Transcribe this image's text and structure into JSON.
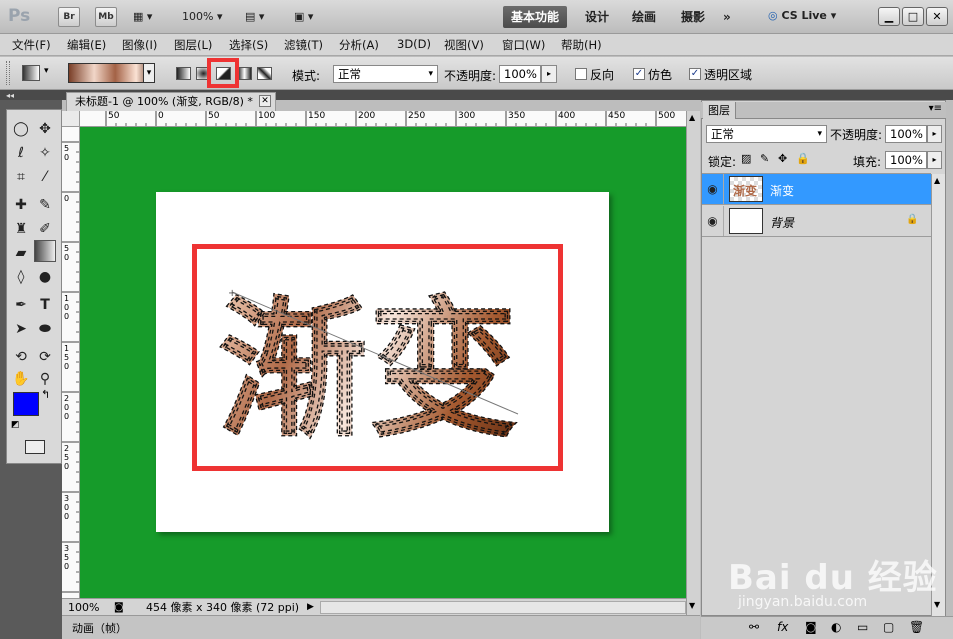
{
  "app": {
    "logo": "Ps",
    "bridge": "Br",
    "minibridge": "Mb",
    "zoom": "100%",
    "workspaces": [
      "基本功能",
      "设计",
      "绘画",
      "摄影"
    ],
    "more": "»",
    "cslive": "CS Live"
  },
  "menu": [
    "文件(F)",
    "编辑(E)",
    "图像(I)",
    "图层(L)",
    "选择(S)",
    "滤镜(T)",
    "分析(A)",
    "3D(D)",
    "视图(V)",
    "窗口(W)",
    "帮助(H)"
  ],
  "options": {
    "mode_label": "模式:",
    "mode_value": "正常",
    "opacity_label": "不透明度:",
    "opacity_value": "100%",
    "reverse_label": "反向",
    "dither_label": "仿色",
    "transparency_label": "透明区域",
    "dither_checked": true,
    "transparency_checked": true,
    "reverse_checked": false
  },
  "document": {
    "tab_title": "未标题-1 @ 100% (渐变, RGB/8) *",
    "ruler_h": [
      "50",
      "0",
      "50",
      "100",
      "150",
      "200",
      "250",
      "300",
      "350",
      "400",
      "450",
      "500"
    ],
    "ruler_v": [
      "5\n0",
      "0",
      "5\n0",
      "1\n0\n0",
      "1\n5\n0",
      "2\n0\n0",
      "2\n5\n0",
      "3\n0\n0",
      "3\n5\n0"
    ],
    "text": "渐变",
    "canvas_bg": "#169b2a"
  },
  "status": {
    "zoom": "100%",
    "info": "454 像素 x 340 像素 (72 ppi)"
  },
  "animation_tab": "动画（帧）",
  "layers": {
    "panel_title": "图层",
    "blend": "正常",
    "opacity_label": "不透明度:",
    "opacity_value": "100%",
    "lock_label": "锁定:",
    "fill_label": "填充:",
    "fill_value": "100%",
    "items": [
      {
        "name": "渐变",
        "selected": true
      },
      {
        "name": "背景",
        "selected": false
      }
    ]
  },
  "colors": {
    "foreground": "#0000ff",
    "background": "#ffffff",
    "selection": "#3399ff",
    "highlight_red": "#ee3333"
  },
  "watermark": {
    "logo": "Bai du 经验",
    "url": "jingyan.baidu.com"
  }
}
